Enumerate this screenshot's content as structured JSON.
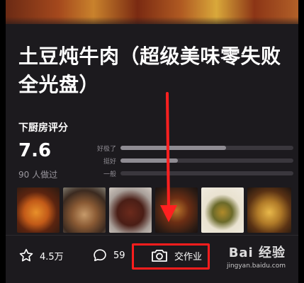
{
  "recipe": {
    "title": "土豆炖牛肉（超级美味零失败全光盘）"
  },
  "rating": {
    "section_label": "下厨房评分",
    "score": "7.6",
    "cooked_count": "90 人做过",
    "bars": [
      {
        "label": "好极了",
        "fraction": 0.61
      },
      {
        "label": "挺好",
        "fraction": 0.33
      },
      {
        "label": "一般",
        "fraction": 0.0
      }
    ]
  },
  "photos": [
    {
      "icon": "dish-photo"
    },
    {
      "icon": "dish-photo"
    },
    {
      "icon": "dish-photo"
    },
    {
      "icon": "dish-photo"
    },
    {
      "icon": "dish-photo"
    },
    {
      "icon": "dish-photo"
    }
  ],
  "actions": {
    "favorite": {
      "icon": "star-icon",
      "count": "4.5万"
    },
    "comment": {
      "icon": "comment-bubble-icon",
      "count": "59"
    },
    "homework": {
      "icon": "camera-icon",
      "label": "交作业"
    }
  },
  "annotation": {
    "highlight_color": "#ff1d1d"
  },
  "watermark": {
    "logo": "Bai 经验",
    "url": "jingyan.baidu.com"
  },
  "colors": {
    "background": "#1c1a1e",
    "text": "#ffffff",
    "muted": "#9a979e",
    "bar_track": "#3a373d",
    "bar_fill": "#8f8c93"
  }
}
